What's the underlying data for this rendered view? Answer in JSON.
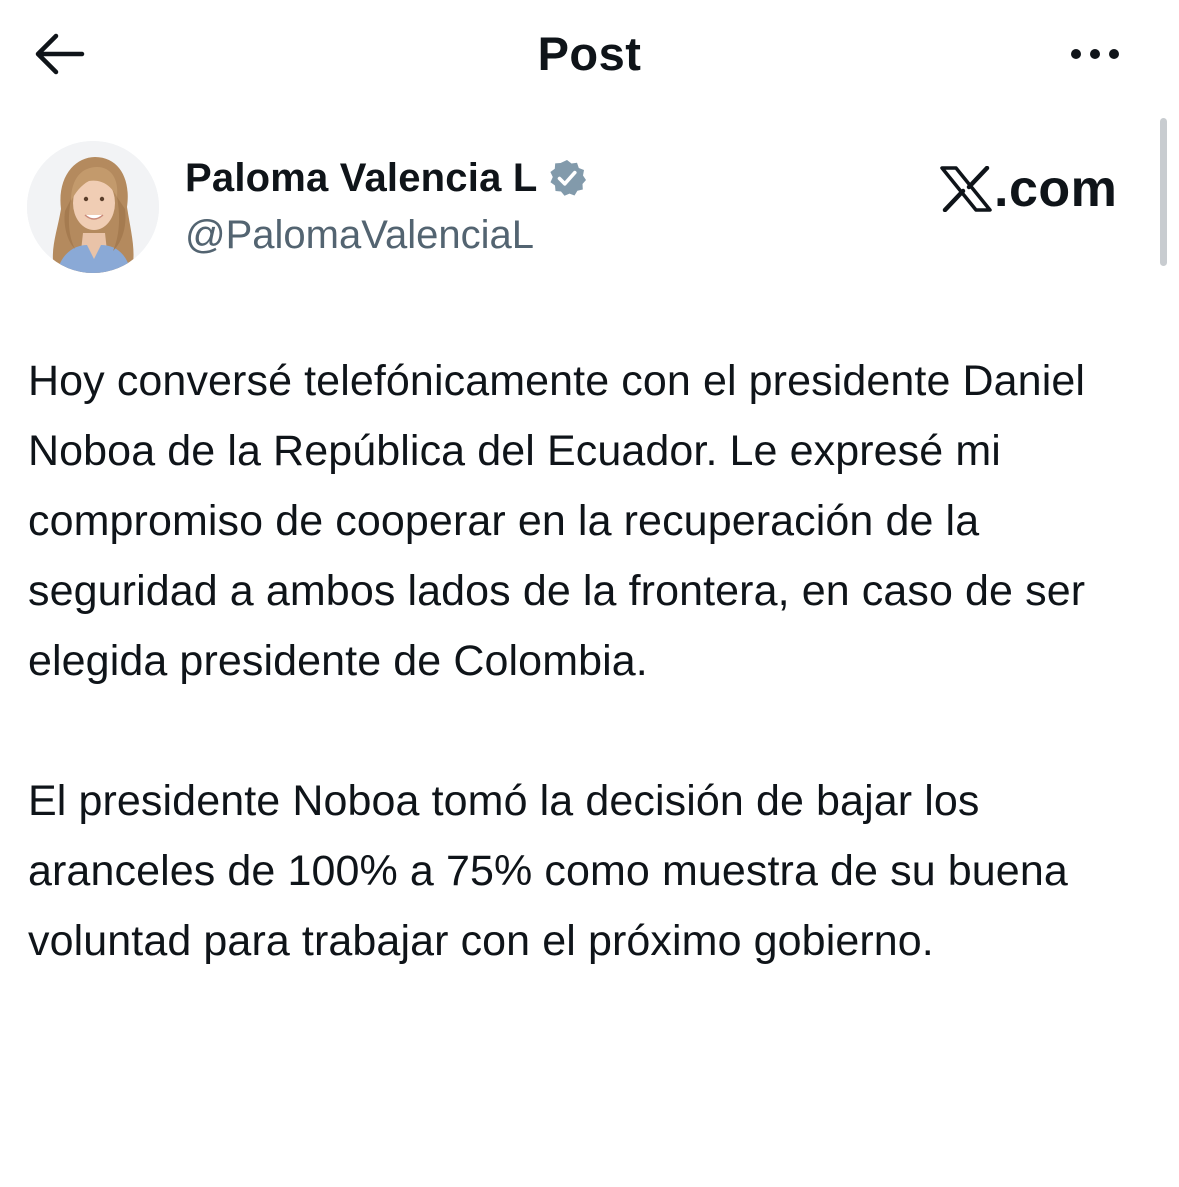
{
  "header": {
    "title": "Post",
    "back_icon": "arrow-left-icon",
    "more_icon": "more-horizontal-icon"
  },
  "author": {
    "name": "Paloma Valencia L",
    "handle": "@PalomaValenciaL",
    "verified": true,
    "verified_color": "#829aab",
    "avatar_icon": "profile-photo"
  },
  "watermark": {
    "icon": "x-logo-icon",
    "text": ".com"
  },
  "post": {
    "paragraphs": [
      "Hoy conversé telefónicamente con el presidente Daniel Noboa de la República del Ecuador. Le expresé mi compromiso de cooperar en la recuperación de la seguridad a ambos lados de la frontera, en caso de ser elegida presidente de Colombia.",
      "El presidente Noboa tomó la decisión de bajar los aranceles de 100% a 75% como muestra de su buena voluntad para trabajar con el próximo gobierno."
    ]
  },
  "colors": {
    "text": "#0f1419",
    "secondary_text": "#536471",
    "background": "#ffffff"
  }
}
